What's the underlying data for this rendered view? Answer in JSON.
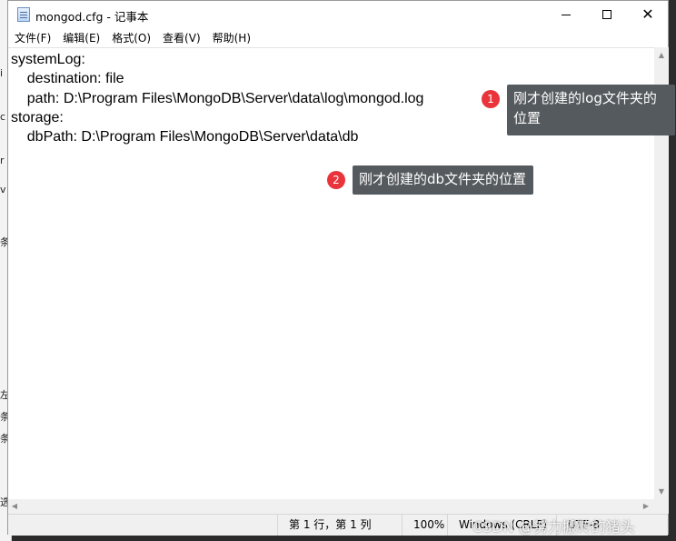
{
  "window": {
    "title": "mongod.cfg - 记事本",
    "minimize_icon": "minimize-icon",
    "maximize_icon": "maximize-icon",
    "close_glyph": "✕"
  },
  "menu": [
    "文件(F)",
    "编辑(E)",
    "格式(O)",
    "查看(V)",
    "帮助(H)"
  ],
  "editor": {
    "content": "systemLog:\n    destination: file\n    path: D:\\Program Files\\MongoDB\\Server\\data\\log\\mongod.log\nstorage:\n    dbPath: D:\\Program Files\\MongoDB\\Server\\data\\db"
  },
  "annotations": [
    {
      "number": "1",
      "text": "刚才创建的log文件夹的\n位置"
    },
    {
      "number": "2",
      "text": "刚才创建的db文件夹的位置"
    }
  ],
  "statusbar": {
    "position": "第 1 行，第 1 列",
    "zoom": "100%",
    "line_ending": "Windows (CRLF)",
    "encoding": "UTF-8"
  },
  "watermark": "CSDN @努力搬砖的猪头",
  "background_strip": [
    "i",
    "c",
    "r",
    "v",
    "条",
    "左",
    "条",
    "条",
    "选"
  ],
  "colors": {
    "annotation_bg": "#555a5e",
    "badge_red": "#e8343a"
  }
}
